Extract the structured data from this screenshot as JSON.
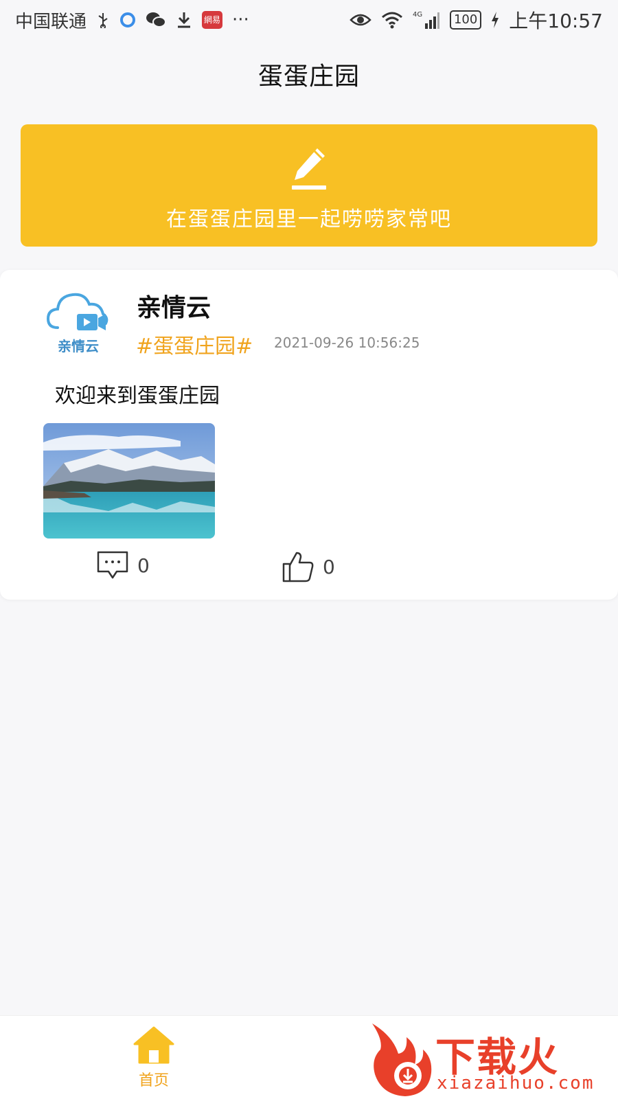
{
  "status_bar": {
    "carrier": "中国联通",
    "app_badge": "網易",
    "more": "···",
    "network": "4G",
    "battery": "100",
    "time": "上午10:57"
  },
  "nav": {
    "title": "蛋蛋庄园"
  },
  "banner": {
    "text": "在蛋蛋庄园里一起唠唠家常吧",
    "color": "#f8c024"
  },
  "post": {
    "avatar_text": "亲情云",
    "author": "亲情云",
    "topic": "#蛋蛋庄园#",
    "time": "2021-09-26 10:56:25",
    "content": "欢迎来到蛋蛋庄园",
    "comment_count": "0",
    "like_count": "0"
  },
  "tab_bar": {
    "items": [
      {
        "label": "首页",
        "icon": "home-icon",
        "active": true
      }
    ],
    "accent": "#f0a31c"
  },
  "watermark": {
    "title": "下载火",
    "url": "xiazaihuo.com"
  }
}
